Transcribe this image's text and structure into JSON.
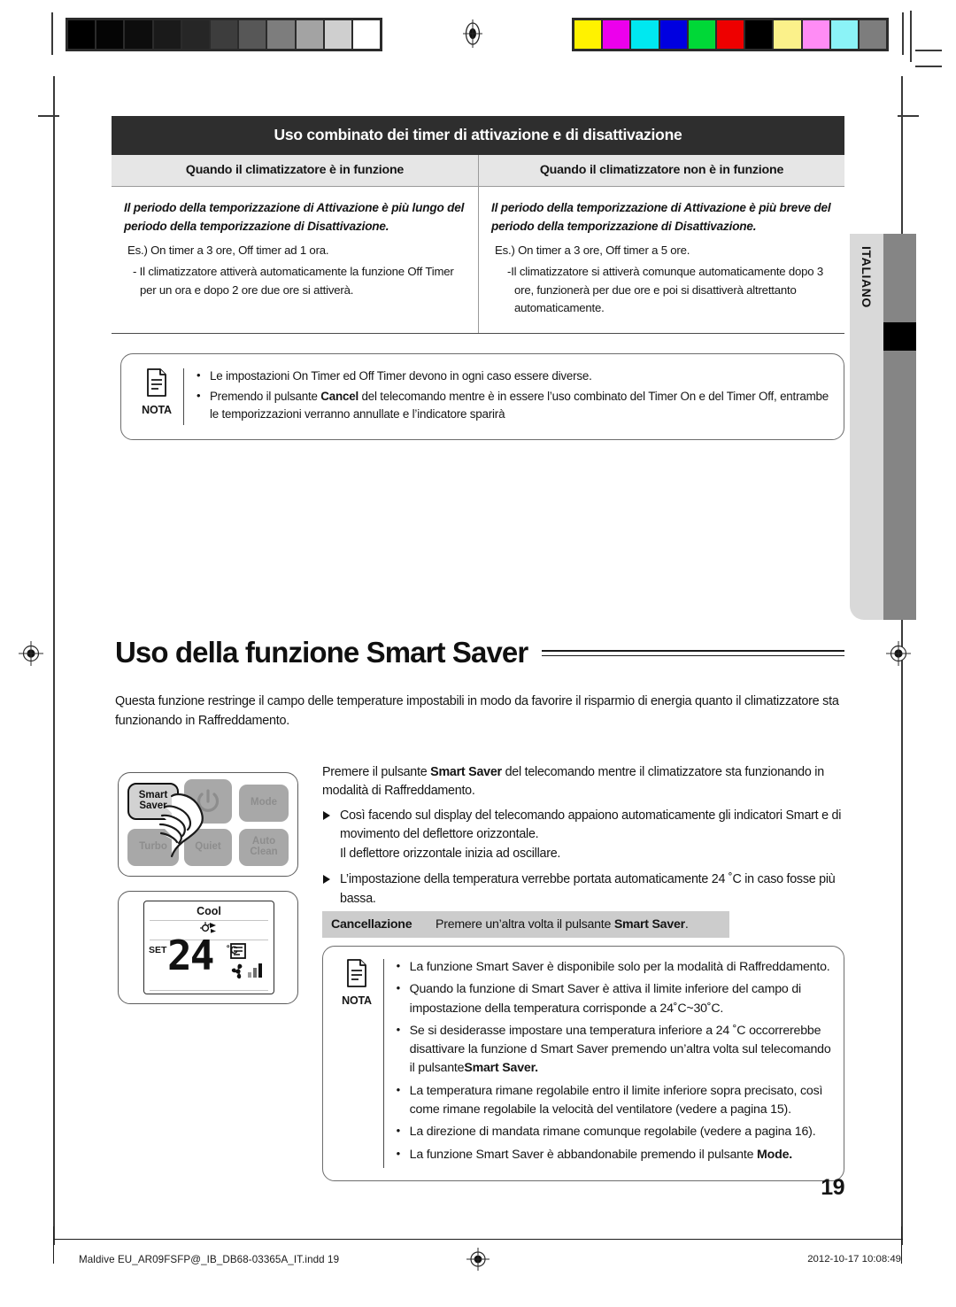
{
  "print_marks": {
    "grayscale_swatches": [
      "#000000",
      "#050505",
      "#0d0d0d",
      "#1a1a1a",
      "#262626",
      "#3d3d3d",
      "#575757",
      "#7d7d7d",
      "#a3a3a3",
      "#cfcfcf",
      "#ffffff"
    ],
    "color_swatches": [
      "#fff200",
      "#ec00ec",
      "#00e8f0",
      "#0000e0",
      "#00d837",
      "#ee0000",
      "#000000",
      "#fbf18a",
      "#ff8cf5",
      "#8bf3f7",
      "#7d7d7d"
    ],
    "registration_mark_icon": "registration-target-icon"
  },
  "language_tab": {
    "label": "ITALIANO"
  },
  "timer_table": {
    "title": "Uso combinato dei timer di attivazione e di disattivazione",
    "headers": [
      "Quando il climatizzatore è in funzione",
      "Quando il climatizzatore non è in funzione"
    ],
    "cells": [
      {
        "lead": "Il periodo della temporizzazione di Attivazione è più lungo del periodo della temporizzazione di Disattivazione.",
        "example": "Es.) On timer a 3 ore, Off timer ad 1 ora.",
        "detail": "- Il climatizzatore attiverà automaticamente la funzione Off Timer per un ora e dopo 2 ore  due ore si attiverà."
      },
      {
        "lead": "Il periodo della temporizzazione di Attivazione è più breve del periodo della temporizzazione di Disattivazione.",
        "example": "Es.) On timer a 3 ore, Off timer a 5 ore.",
        "detail": "-Il climatizzatore si attiverà comunque automaticamente dopo 3 ore, funzionerà per due ore e poi si disattiverà altrettanto automaticamente."
      }
    ]
  },
  "note_timer": {
    "badge_label": "NOTA",
    "badge_icon": "note-document-icon",
    "items": [
      {
        "pre": "Le impostazioni On Timer ed Off Timer devono in ogni caso essere diverse.",
        "bold": "",
        "post": ""
      },
      {
        "pre": "Premendo il pulsante ",
        "bold": "Cancel",
        "post": "  del telecomando mentre è in essere l’uso combinato del Timer On e del Timer Off, entrambe le temporizzazioni verranno annullate e l’indicatore sparirà"
      }
    ]
  },
  "section": {
    "heading": "Uso della funzione Smart Saver",
    "intro": "Questa funzione restringe il campo delle temperature impostabili in modo da favorire il risparmio di energia quanto il climatizzatore sta funzionando in Raffreddamento."
  },
  "remote": {
    "buttons": [
      {
        "name": "smart-saver",
        "label": "Smart Saver",
        "state": "active"
      },
      {
        "name": "power",
        "label": "",
        "state": "dim"
      },
      {
        "name": "mode",
        "label": "Mode",
        "state": "dim"
      },
      {
        "name": "turbo",
        "label": "Turbo",
        "state": "dim"
      },
      {
        "name": "quiet",
        "label": "Quiet",
        "state": "dim"
      },
      {
        "name": "auto-clean",
        "label": "Auto Clean",
        "state": "dim"
      }
    ],
    "hand_icon": "pointing-hand-icon",
    "display": {
      "mode": "Cool",
      "smart_icon": "smart-saver-indicator-icon",
      "set_label": "SET",
      "temperature": "24",
      "unit": "˚C",
      "deflector_icon": "horizontal-swing-icon",
      "fan_icon": "fan-icon",
      "fan_level_icon": "fan-speed-bars-icon"
    }
  },
  "instructions": {
    "intro_pre": "Premere il pulsante ",
    "intro_bold": "Smart Saver",
    "intro_post": " del telecomando mentre il climatizzatore sta funzionando in modalità di Raffreddamento.",
    "bullets": [
      "Così facendo sul display del telecomando appaiono automaticamente gli indicatori Smart e di movimento del deflettore orizzontale.\nIl deflettore orizzontale inizia ad oscillare.",
      "L’impostazione della temperatura verrebbe portata automaticamente  24 ˚C in caso fosse più bassa."
    ]
  },
  "cancellazione": {
    "label": "Cancellazione",
    "value_pre": "Premere un’altra volta  il pulsante ",
    "value_bold": "Smart Saver",
    "value_post": "."
  },
  "note_smartsaver": {
    "badge_label": "NOTA",
    "badge_icon": "note-document-icon",
    "items": [
      {
        "pre": "La funzione Smart Saver è disponibile solo per la modalità di Raffreddamento.",
        "bold": "",
        "post": ""
      },
      {
        "pre": "Quando la funzione di Smart Saver è attiva il limite inferiore del campo di impostazione della temperatura corrisponde a 24˚C~30˚C.",
        "bold": "",
        "post": ""
      },
      {
        "pre": "Se si desiderasse impostare una temperatura inferiore a 24 ˚C occorrerebbe disattivare la funzione d Smart Saver premendo un’altra volta sul telecomando il pulsante",
        "bold": "Smart Saver.",
        "post": ""
      },
      {
        "pre": "La temperatura rimane regolabile entro il limite inferiore sopra precisato, così come rimane regolabile la velocità del ventilatore (vedere a pagina 15).",
        "bold": "",
        "post": ""
      },
      {
        "pre": "La direzione di mandata rimane comunque regolabile (vedere a pagina 16).",
        "bold": "",
        "post": ""
      },
      {
        "pre": "La funzione Smart Saver è abbandonabile premendo il pulsante ",
        "bold": "Mode.",
        "post": ""
      }
    ]
  },
  "page_number": "19",
  "footer": {
    "file_name": "Maldive EU_AR09FSFP@_IB_DB68-03365A_IT.indd   19",
    "timestamp": "2012-10-17   10:08:49",
    "registration_mark_icon": "registration-target-icon"
  }
}
